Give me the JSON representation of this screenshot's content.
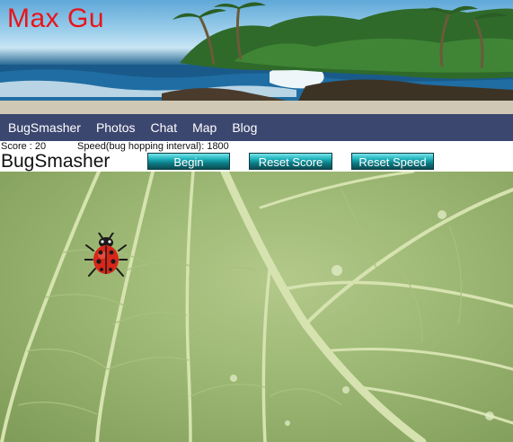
{
  "header": {
    "site_title": "Max Gu"
  },
  "nav": {
    "items": [
      "BugSmasher",
      "Photos",
      "Chat",
      "Map",
      "Blog"
    ]
  },
  "status": {
    "score_text": "Score : 20",
    "speed_text": "Speed(bug hopping interval): 1800",
    "score": 20,
    "hop_interval": 1800
  },
  "game": {
    "title": "BugSmasher",
    "begin_label": "Begin",
    "reset_score_label": "Reset Score",
    "reset_speed_label": "Reset Speed",
    "bug_icon": "ladybug-icon"
  },
  "colors": {
    "title_red": "#e8141b",
    "nav_bg": "#3c4770",
    "button_teal": "#1fb3bd",
    "leaf_green": "#9cb773"
  }
}
